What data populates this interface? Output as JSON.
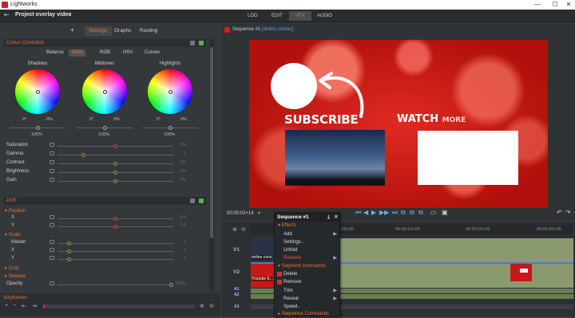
{
  "app": {
    "name": "Lightworks",
    "project": "Project overlay video"
  },
  "window": {
    "minimize": "—",
    "maximize": "☐",
    "close": "✕"
  },
  "rooms": [
    "LOG",
    "EDIT",
    "VFX",
    "AUDIO"
  ],
  "active_room": "VFX",
  "panel": {
    "add": "+",
    "tabs": [
      "Settings",
      "Graphs",
      "Routing"
    ],
    "active_tab": "Settings"
  },
  "colour_correction": {
    "title": "Colour Correction",
    "tabs": [
      "Balance",
      "Main",
      "RGB",
      "HSV",
      "Curves"
    ],
    "active_tab": "Main",
    "wheels": [
      {
        "label": "Shadows",
        "left": "0°",
        "right": "0%",
        "pct": "100%"
      },
      {
        "label": "Midtones",
        "left": "0°",
        "right": "0%",
        "pct": "100%"
      },
      {
        "label": "Highlights",
        "left": "0°",
        "right": "0%",
        "pct": "100%"
      }
    ],
    "rows": [
      {
        "label": "Saturation",
        "value": "0%"
      },
      {
        "label": "Gamma",
        "value": "1"
      },
      {
        "label": "Contrast",
        "value": "0%"
      },
      {
        "label": "Brightness",
        "value": "0%"
      },
      {
        "label": "Gain",
        "value": "0%"
      }
    ]
  },
  "dve": {
    "title": "DVE",
    "position": {
      "label": "Position",
      "x_label": "X",
      "x_value": "0.5",
      "y_label": "Y",
      "y_value": "0.5"
    },
    "scale": {
      "label": "Scale",
      "master_label": "Master",
      "master_value": "1",
      "x_label": "X",
      "x_value": "1",
      "y_label": "Y",
      "y_value": "1"
    },
    "crop": "Crop",
    "shadow": "Shadow",
    "opacity_label": "Opacity",
    "opacity_value": "100%"
  },
  "keyframes": {
    "label": "Keyframes"
  },
  "viewer": {
    "sequence": "Sequence #1",
    "tag": "[online conver]",
    "timecode": "00:00:02+14",
    "subscribe": "SUBSCRIBE",
    "watch": "WATCH",
    "more": "MORE"
  },
  "timeline": {
    "ruler": [
      "00:00:05+00",
      "00:00:10+00",
      "00:00:15+00",
      "00:00:20+00"
    ],
    "tracks": [
      "V1",
      "V2",
      "A1",
      "A2",
      "A3"
    ],
    "clip_v1": "online conv",
    "clip_v2": "Youtube E..."
  },
  "context_menu": {
    "title": "Sequence #1",
    "effects": "Effects",
    "add": "Add",
    "settings": "Settings..",
    "unfold": "Unfold",
    "remove_effect": "Remove",
    "segment_commands": "Segment commands",
    "delete": "Delete",
    "remove": "Remove",
    "trim": "Trim",
    "reveal": "Reveal",
    "speed": "Speed..",
    "sequence_commands": "Sequence Commands"
  },
  "colors": {
    "accent": "#e8742a",
    "brand": "#d21e1e",
    "link": "#5aa0e6"
  }
}
